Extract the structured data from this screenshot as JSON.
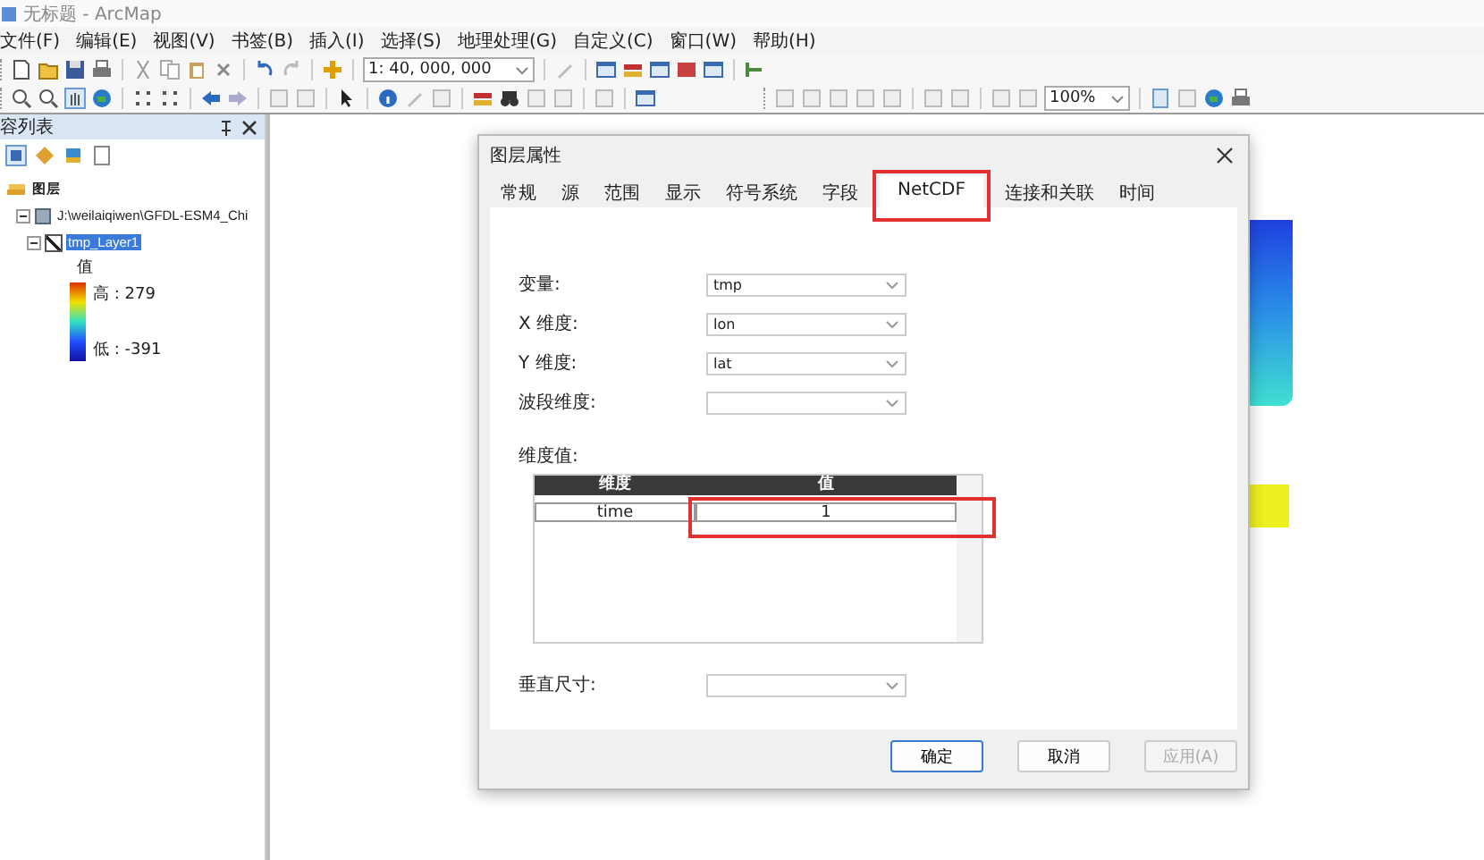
{
  "window": {
    "title": "无标题 - ArcMap"
  },
  "menu": [
    "文件(F)",
    "编辑(E)",
    "视图(V)",
    "书签(B)",
    "插入(I)",
    "选择(S)",
    "地理处理(G)",
    "自定义(C)",
    "窗口(W)",
    "帮助(H)"
  ],
  "toolbar": {
    "scale": "1: 40, 000, 000",
    "zoom": "100%"
  },
  "toc": {
    "title": "容列表",
    "tree": [
      {
        "label": "图层",
        "children": [
          {
            "label": "J:\\weilaiqiwen\\GFDL-ESM4_Chi",
            "expanded": true,
            "children": [
              {
                "label": "tmp_Layer1",
                "expanded": true,
                "checked": true,
                "selected": true,
                "legend": {
                  "heading": "值",
                  "high": "高 : 279",
                  "low": "低 : -391"
                }
              }
            ]
          }
        ]
      }
    ]
  },
  "dialog": {
    "title": "图层属性",
    "tabs": [
      {
        "label": "常规",
        "selected": false
      },
      {
        "label": "源",
        "selected": false
      },
      {
        "label": "范围",
        "selected": false
      },
      {
        "label": "显示",
        "selected": false
      },
      {
        "label": "符号系统",
        "selected": false
      },
      {
        "label": "字段",
        "selected": false
      },
      {
        "label": "NetCDF",
        "selected": true
      },
      {
        "label": "连接和关联",
        "selected": false
      },
      {
        "label": "时间",
        "selected": false
      }
    ],
    "fields": [
      {
        "label": "变量:",
        "value": "tmp"
      },
      {
        "label": "X 维度:",
        "value": "lon"
      },
      {
        "label": "Y 维度:",
        "value": "lat"
      },
      {
        "label": "波段维度:"
      }
    ],
    "dimension_values": {
      "label": "维度值:",
      "columns": [
        "维度",
        "值"
      ],
      "rows": [
        [
          "time",
          "1"
        ]
      ]
    },
    "vertical": {
      "label": "垂直尺寸:"
    },
    "buttons": [
      {
        "label": "确定",
        "default": true,
        "disabled": false
      },
      {
        "label": "取消",
        "default": false,
        "disabled": false
      },
      {
        "label": "应用(A)",
        "default": false,
        "disabled": true
      }
    ]
  }
}
